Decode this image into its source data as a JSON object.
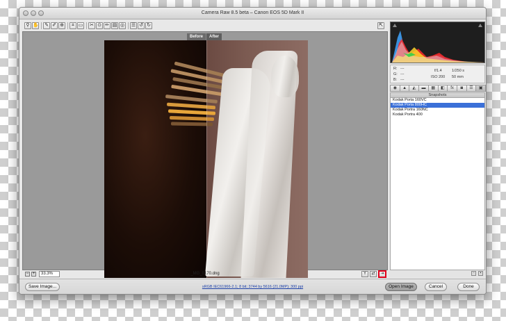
{
  "window": {
    "title": "Camera Raw 8.5 beta  –  Canon EOS 5D Mark II"
  },
  "toolbar": {
    "tools": [
      {
        "icon": "zoom-icon",
        "glyph": "⚲"
      },
      {
        "icon": "hand-icon",
        "glyph": "✋"
      },
      {
        "icon": "white-balance-icon",
        "glyph": "✎"
      },
      {
        "icon": "color-sampler-icon",
        "glyph": "✐"
      },
      {
        "icon": "targeted-adjustment-icon",
        "glyph": "⊕"
      },
      {
        "icon": "crop-icon",
        "glyph": "⌗"
      },
      {
        "icon": "straighten-icon",
        "glyph": "▭"
      },
      {
        "icon": "spot-removal-icon",
        "glyph": "✂"
      },
      {
        "icon": "red-eye-icon",
        "glyph": "⊙"
      },
      {
        "icon": "adjustment-brush-icon",
        "glyph": "✏"
      },
      {
        "icon": "graduated-filter-icon",
        "glyph": "▤"
      },
      {
        "icon": "radial-filter-icon",
        "glyph": "◎"
      },
      {
        "icon": "preferences-icon",
        "glyph": "☰"
      },
      {
        "icon": "rotate-left-icon",
        "glyph": "↺"
      },
      {
        "icon": "rotate-right-icon",
        "glyph": "↻"
      }
    ],
    "fullscreen_glyph": "⇱"
  },
  "preview": {
    "before_label": "Before",
    "after_label": "After"
  },
  "status": {
    "zoom_value": "33.3%",
    "filename": "_MG_0170.dng",
    "view_buttons": [
      {
        "icon": "cycle-view-icon",
        "glyph": "Y",
        "active": false
      },
      {
        "icon": "swap-settings-icon",
        "glyph": "⇄",
        "active": false
      },
      {
        "icon": "copy-settings-icon",
        "glyph": "⇥",
        "active": true
      }
    ]
  },
  "info": {
    "r_label": "R:",
    "r_value": "---",
    "g_label": "G:",
    "g_value": "---",
    "b_label": "B:",
    "b_value": "---",
    "aperture": "f/1.4",
    "shutter": "1/250 s",
    "iso": "ISO 200",
    "focal": "50 mm"
  },
  "panel_tabs": [
    "◉",
    "▲",
    "◭",
    "▬",
    "▦",
    "◧",
    "fx",
    "◙",
    "☰",
    "▣"
  ],
  "snapshots": {
    "header": "Snapshots",
    "items": [
      {
        "label": "Kodak Porta 160VC",
        "selected": false
      },
      {
        "label": "Kodak Porta 800HC",
        "selected": true
      },
      {
        "label": "Kodak Portra 160NC",
        "selected": false
      },
      {
        "label": "Kodak Portra 400",
        "selected": false
      }
    ]
  },
  "footer": {
    "save_label": "Save Image...",
    "workflow_link": "sRGB IEC61966-2.1; 8 bit; 3744 by 5616 (21.0MP); 300 ppi",
    "open_label": "Open Image",
    "cancel_label": "Cancel",
    "done_label": "Done"
  },
  "colors": {
    "selection": "#3b70d8",
    "highlight_box": "#e0001b"
  }
}
